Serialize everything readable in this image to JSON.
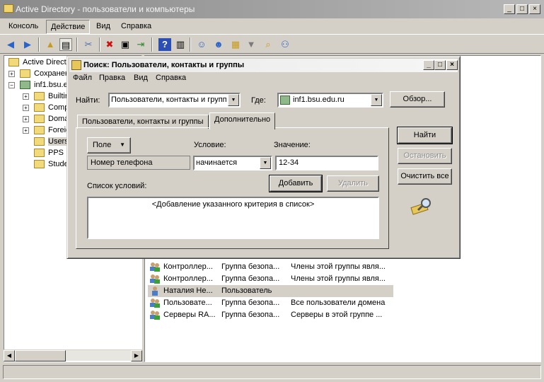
{
  "window": {
    "title": "Active Directory - пользователи и компьютеры",
    "controls": [
      "_",
      "□",
      "×"
    ]
  },
  "menu": {
    "items": [
      "Консоль",
      "Действие",
      "Вид",
      "Справка"
    ]
  },
  "tree": {
    "items": [
      {
        "label": "Active Directo"
      },
      {
        "label": "Сохранен"
      },
      {
        "label": "inf1.bsu.e"
      },
      {
        "label": "Builtin"
      },
      {
        "label": "Comp"
      },
      {
        "label": "Doma"
      },
      {
        "label": "Foreig"
      },
      {
        "label": "Users"
      },
      {
        "label": "PPS"
      },
      {
        "label": "Stude"
      }
    ]
  },
  "list": {
    "rows": [
      {
        "name": "Контроллер...",
        "type": "Группа безопа...",
        "desc": "Члены этой группы явля...",
        "icon": "group-icon"
      },
      {
        "name": "Контроллер...",
        "type": "Группа безопа...",
        "desc": "Члены этой группы явля...",
        "icon": "group-icon"
      },
      {
        "name": "Наталия Не...",
        "type": "Пользователь",
        "desc": "",
        "icon": "user-icon"
      },
      {
        "name": "Пользовате...",
        "type": "Группа безопа...",
        "desc": "Все пользователи домена",
        "icon": "group-icon"
      },
      {
        "name": "Серверы RA...",
        "type": "Группа безопа...",
        "desc": "Серверы в этой группе ...",
        "icon": "group-icon"
      }
    ]
  },
  "dialog": {
    "title": "Поиск: Пользователи, контакты и группы",
    "menu": [
      "Файл",
      "Правка",
      "Вид",
      "Справка"
    ],
    "find_label": "Найти:",
    "find_value": "Пользователи, контакты и групп",
    "where_label": "Где:",
    "where_value": "inf1.bsu.edu.ru",
    "browse": "Обзор...",
    "tabs": [
      "Пользователи, контакты и группы",
      "Дополнительно"
    ],
    "field_button": "Поле",
    "condition_label": "Условие:",
    "value_label": "Значение:",
    "field_value": "Номер телефона",
    "condition_value": "начинается",
    "value_value": "12-34",
    "add_button": "Добавить",
    "remove_button": "Удалить",
    "conditions_label": "Список условий:",
    "conditions_placeholder": "<Добавление указанного критерия в список>",
    "find_now": "Найти",
    "stop": "Остановить",
    "clear_all": "Очистить все"
  }
}
